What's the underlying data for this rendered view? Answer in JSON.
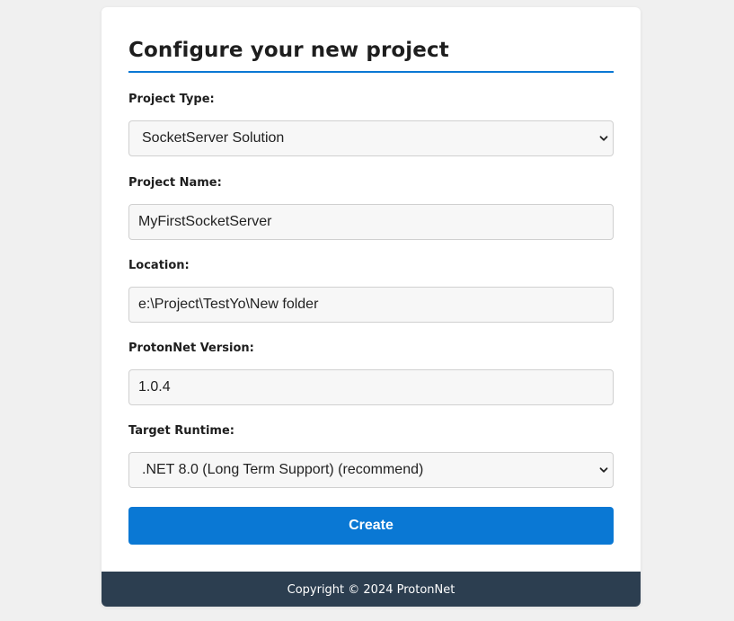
{
  "page": {
    "title": "Configure your new project"
  },
  "form": {
    "project_type": {
      "label": "Project Type:",
      "selected": "SocketServer Solution"
    },
    "project_name": {
      "label": "Project Name:",
      "value": "MyFirstSocketServer"
    },
    "location": {
      "label": "Location:",
      "value": "e:\\Project\\TestYo\\New folder"
    },
    "protonnet_version": {
      "label": "ProtonNet Version:",
      "value": "1.0.4"
    },
    "target_runtime": {
      "label": "Target Runtime:",
      "selected": ".NET 8.0 (Long Term Support) (recommend)"
    },
    "create_label": "Create"
  },
  "footer": {
    "text": "Copyright © 2024 ProtonNet"
  },
  "icons": {
    "dropdown": "chevron-down-icon"
  },
  "colors": {
    "accent": "#0a78d4",
    "footer_bg": "#2c3e50",
    "page_bg": "#f0f0f0"
  }
}
